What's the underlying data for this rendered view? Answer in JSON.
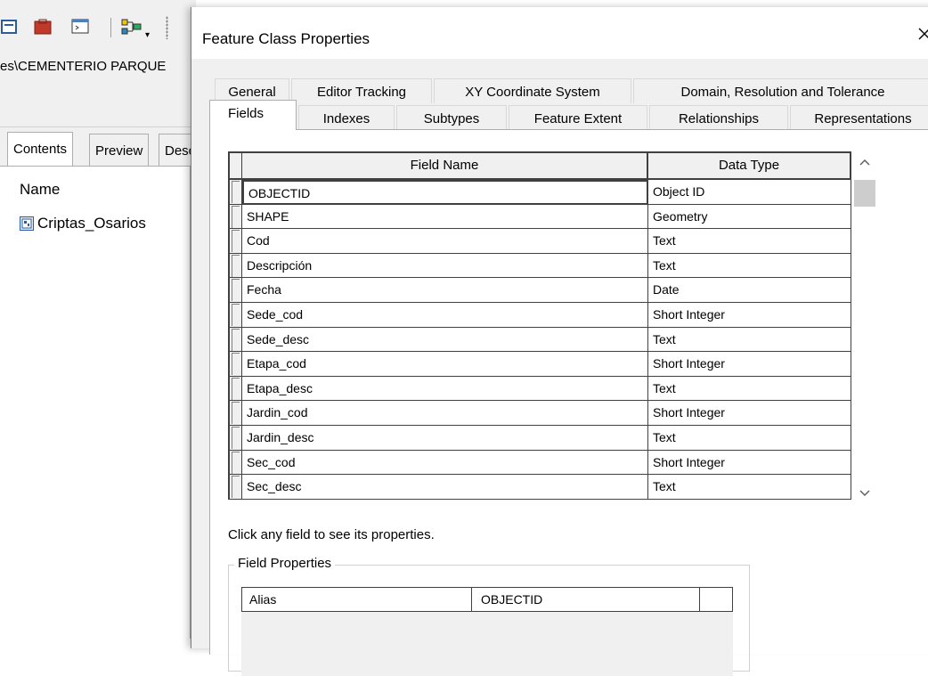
{
  "background": {
    "location_path": "es\\CEMENTERIO PARQUE",
    "tabs": {
      "contents": "Contents",
      "preview": "Preview",
      "description": "Description"
    },
    "contents_header": "Name",
    "items": [
      {
        "label": "Criptas_Osarios",
        "icon": "feature-class-icon"
      }
    ]
  },
  "dialog": {
    "title": "Feature Class Properties",
    "close_glyph": "✕",
    "tabs_row1": {
      "general": "General",
      "editor_tracking": "Editor Tracking",
      "xy": "XY Coordinate System",
      "domain": "Domain, Resolution and Tolerance"
    },
    "tabs_row2": {
      "fields": "Fields",
      "indexes": "Indexes",
      "subtypes": "Subtypes",
      "extent": "Feature Extent",
      "relationships": "Relationships",
      "representations": "Representations"
    },
    "grid": {
      "col_name": "Field Name",
      "col_type": "Data Type",
      "rows": [
        {
          "name": "OBJECTID",
          "type": "Object ID"
        },
        {
          "name": "SHAPE",
          "type": "Geometry"
        },
        {
          "name": "Cod",
          "type": "Text"
        },
        {
          "name": "Descripción",
          "type": "Text"
        },
        {
          "name": "Fecha",
          "type": "Date"
        },
        {
          "name": "Sede_cod",
          "type": "Short Integer"
        },
        {
          "name": "Sede_desc",
          "type": "Text"
        },
        {
          "name": "Etapa_cod",
          "type": "Short Integer"
        },
        {
          "name": "Etapa_desc",
          "type": "Text"
        },
        {
          "name": "Jardin_cod",
          "type": "Short Integer"
        },
        {
          "name": "Jardin_desc",
          "type": "Text"
        },
        {
          "name": "Sec_cod",
          "type": "Short Integer"
        },
        {
          "name": "Sec_desc",
          "type": "Text"
        }
      ]
    },
    "hint": "Click any field to see its properties.",
    "field_properties": {
      "legend": "Field Properties",
      "alias_label": "Alias",
      "alias_value": "OBJECTID"
    }
  }
}
